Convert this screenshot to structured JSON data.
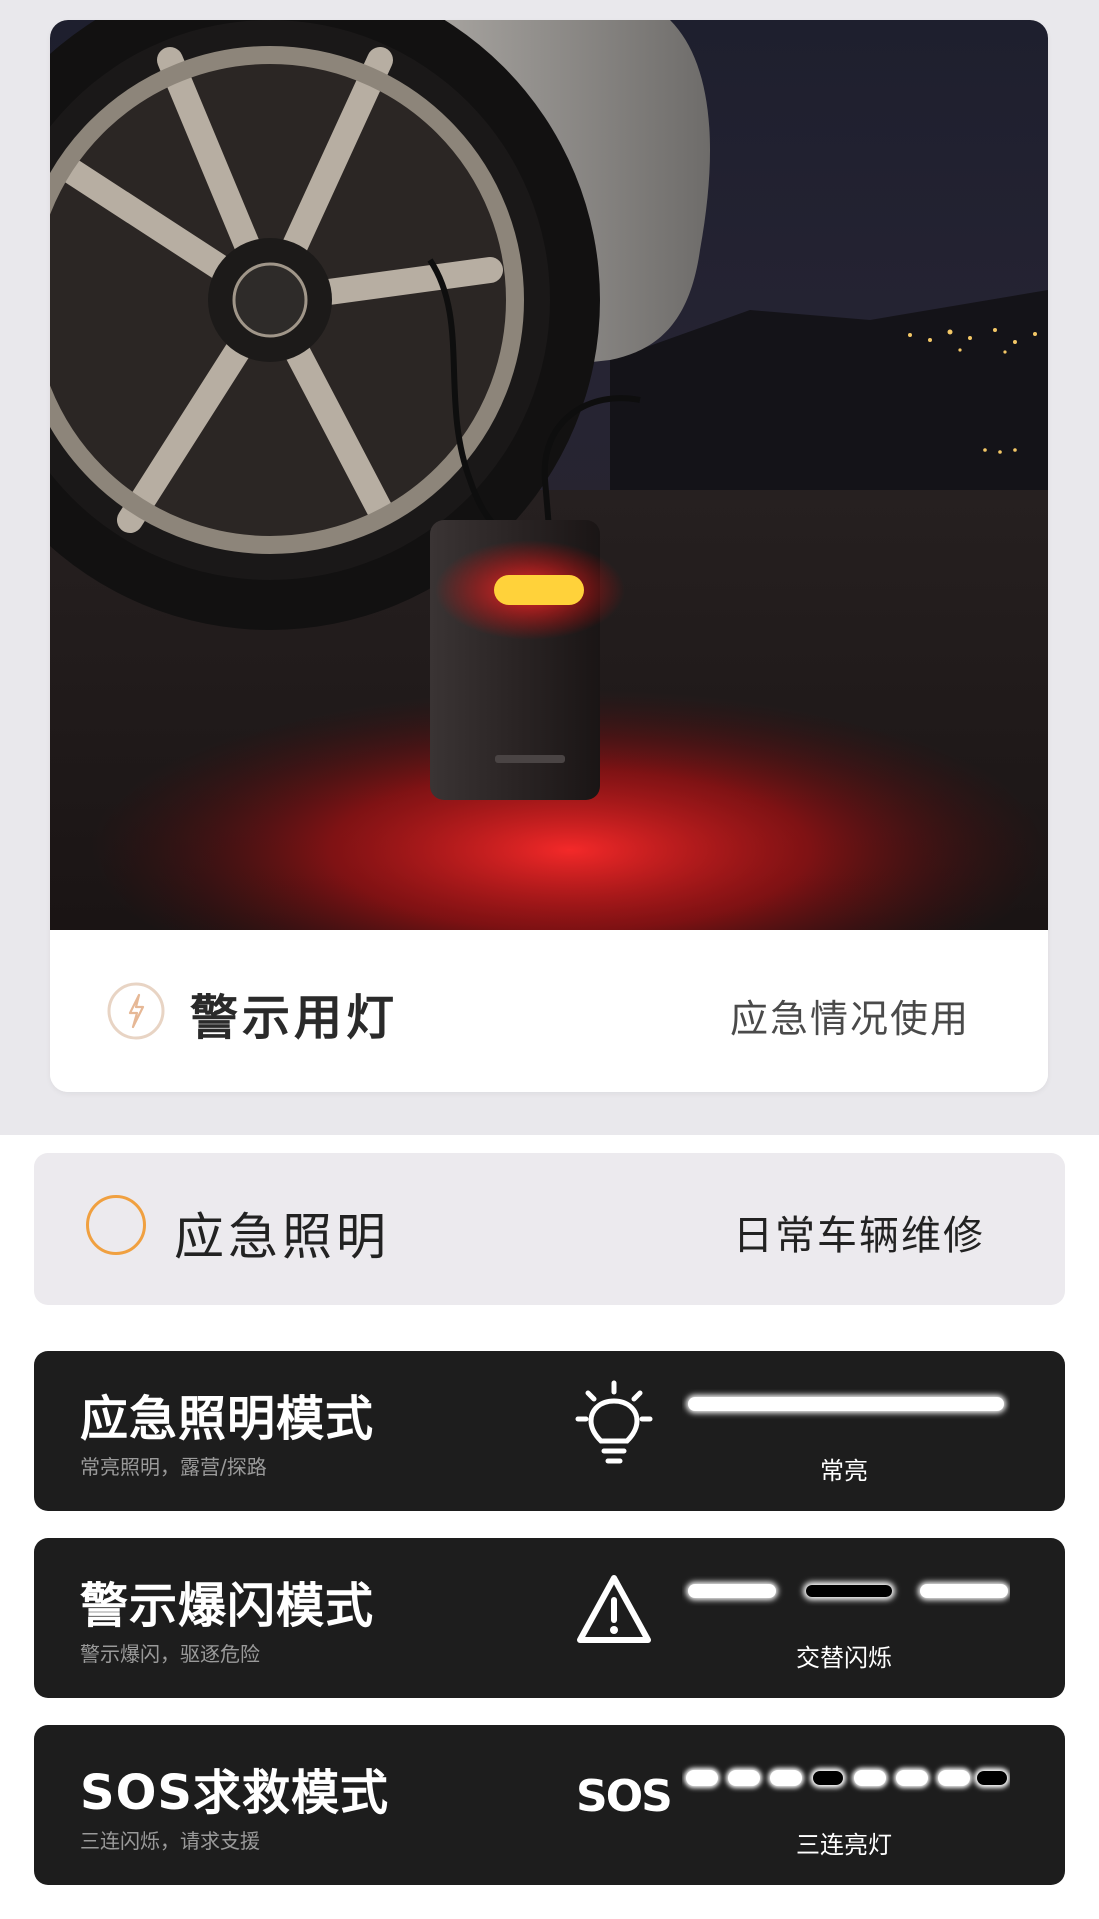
{
  "hero": {
    "caption_title": "警示用灯",
    "caption_subtitle": "应急情况使用",
    "icon": "lightning-circle-icon"
  },
  "mode_selector": {
    "title": "应急照明",
    "subtitle": "日常车辆维修",
    "accent": "#f0a040"
  },
  "modes": [
    {
      "title": "应急照明模式",
      "subtitle": "常亮照明，露营/探路",
      "icon": "lightbulb-icon",
      "label": "常亮",
      "pattern": "solid"
    },
    {
      "title": "警示爆闪模式",
      "subtitle": "警示爆闪，驱逐危险",
      "icon": "warning-triangle-icon",
      "label": "交替闪烁",
      "pattern": "alternate"
    },
    {
      "title": "SOS求救模式",
      "subtitle": "三连闪烁，请求支援",
      "icon": "sos-icon",
      "icon_text": "SOS",
      "label": "三连亮灯",
      "pattern": "sos"
    }
  ]
}
